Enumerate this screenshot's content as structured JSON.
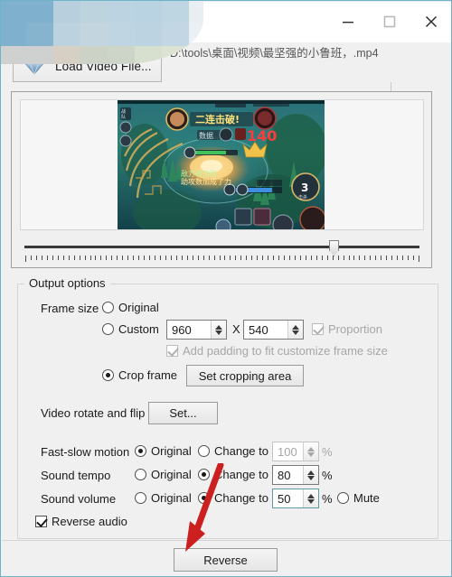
{
  "window": {
    "title_redacted": true,
    "border_color": "#6fb3c9",
    "controls": {
      "minimize": "minimize-icon",
      "maximize": "maximize-icon",
      "close": "close-icon"
    }
  },
  "toolbar": {
    "load_button_label": "Load Video File...",
    "load_button_icon": "gem-folder-icon",
    "file_path": "D:\\tools\\桌面\\视频\\最坚强的小鲁班，.mp4"
  },
  "preview": {
    "video_caption_combo": "二连击破!",
    "video_damage_number": "140",
    "video_counter": "3",
    "trackbar": {
      "position_percent": 78,
      "tick_count": 74
    }
  },
  "output_options": {
    "group_title": "Output options",
    "frame_size": {
      "label": "Frame size",
      "original_label": "Original",
      "original_selected": false,
      "custom_label": "Custom",
      "custom_selected": false,
      "width": "960",
      "height": "540",
      "x_separator": "X",
      "proportion_label": "Proportion",
      "proportion_checked": true,
      "proportion_enabled": false,
      "padding_label": "Add padding to fit customize frame size",
      "padding_checked": true,
      "padding_enabled": false,
      "crop_label": "Crop frame",
      "crop_selected": true,
      "set_crop_button": "Set cropping area"
    },
    "rotate_flip": {
      "label": "Video rotate and flip",
      "button": "Set..."
    },
    "fast_slow_motion": {
      "label": "Fast-slow motion",
      "original_label": "Original",
      "change_label": "Change to",
      "selected": "original",
      "value": "100",
      "unit": "%",
      "enabled": false
    },
    "sound_tempo": {
      "label": "Sound tempo",
      "original_label": "Original",
      "change_label": "Change to",
      "selected": "change",
      "value": "80",
      "unit": "%",
      "enabled": true
    },
    "sound_volume": {
      "label": "Sound volume",
      "original_label": "Original",
      "change_label": "Change to",
      "selected": "change",
      "value": "50",
      "unit": "%",
      "mute_label": "Mute",
      "mute_selected": false,
      "enabled": true,
      "focused": true
    },
    "reverse_audio": {
      "label": "Reverse audio",
      "checked": true
    }
  },
  "footer": {
    "reverse_button": "Reverse"
  },
  "annotation": {
    "arrow_color": "#cc1f1f",
    "points_to": "reverse-button"
  }
}
